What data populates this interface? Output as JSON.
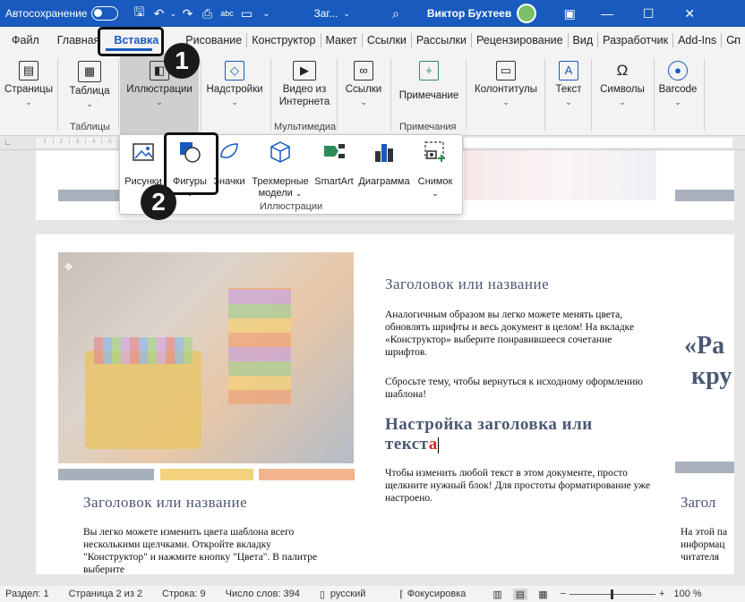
{
  "titlebar": {
    "autosave": "Автосохранение",
    "doc_title": "Заг...",
    "user": "Виктор Бухтеев"
  },
  "tabs": [
    "Файл",
    "Главная",
    "Вставка",
    "Рисование",
    "Конструктор",
    "Макет",
    "Ссылки",
    "Рассылки",
    "Рецензирование",
    "Вид",
    "Разработчик",
    "Add-Ins",
    "Сп"
  ],
  "active_tab": "Вставка",
  "ribbon": {
    "pages": "Страницы",
    "table": "Таблица",
    "tables_group": "Таблицы",
    "illustrations": "Иллюстрации",
    "addins": "Надстройки",
    "video_l1": "Видео из",
    "video_l2": "Интернета",
    "media_group": "Мультимедиа",
    "links": "Ссылки",
    "comment": "Примечание",
    "comments_group": "Примечания",
    "header_footer": "Колонтитулы",
    "text": "Текст",
    "symbols": "Символы",
    "barcode": "Barcode"
  },
  "dropdown": {
    "pictures": "Рисунки",
    "shapes": "Фигуры",
    "icons": "Значки",
    "models_l1": "Трехмерные",
    "models_l2": "модели",
    "smartart": "SmartArt",
    "chart": "Диаграмма",
    "screenshot": "Снимок",
    "group_label": "Иллюстрации"
  },
  "ruler_text": "· 1 · | · 2 · | · 3 · | · 4 · | · 5 ·",
  "callouts": [
    "1",
    "2"
  ],
  "document": {
    "h1": "Заголовок или название",
    "p1": "Аналогичным образом вы легко можете менять цвета, обновлять шрифты и весь документ в целом! На вкладке «Конструктор» выберите понравившееся сочетание шрифтов.",
    "p2": "Сбросьте тему, чтобы вернуться к исходному оформлению шаблона!",
    "h2_a": "Настройка заголовка или",
    "h2_b": "текст",
    "h2_c": "а",
    "p3": "Чтобы изменить любой текст в этом документе, просто щелкните нужный блок! Для простоты форматирование уже настроено.",
    "left_h": "Заголовок или название",
    "left_p": "Вы легко можете изменить цвета шаблона всего несколькими щелчками. Откройте вкладку \"Конструктор\" и нажмите кнопку \"Цвета\". В палитре выберите",
    "quote_l1": "«Ра",
    "quote_l2": "кру",
    "right_h": "Загол",
    "right_p1": "На этой па",
    "right_p2": "информац",
    "right_p3": "читателя"
  },
  "statusbar": {
    "section": "Раздел: 1",
    "page": "Страница 2 из 2",
    "line": "Строка: 9",
    "words": "Число слов: 394",
    "lang": "русский",
    "focus": "Фокусировка",
    "zoom": "100 %"
  },
  "colors": {
    "accent": "#185abd",
    "bar_gray": "#a8b0bd",
    "bar_yellow": "#f2d27c",
    "bar_orange": "#f0b48e"
  }
}
